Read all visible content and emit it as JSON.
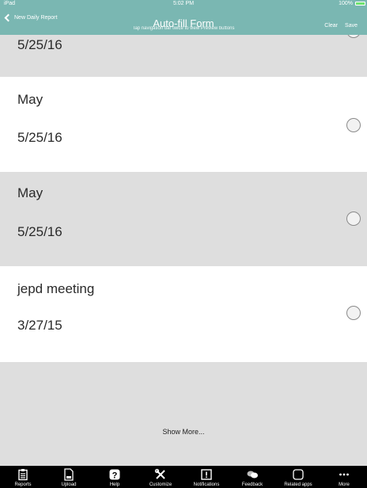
{
  "status_bar": {
    "carrier": "iPad",
    "time": "5:02 PM",
    "battery": "100%"
  },
  "nav": {
    "back_label": "New Daily Report",
    "title": "Auto-fill Form",
    "subtitle": "Tap navigation bar twice to view Preview buttons",
    "clear_label": "Clear",
    "save_label": "Save"
  },
  "rows": [
    {
      "title": "",
      "date": "5/25/16"
    },
    {
      "title": "May",
      "date": "5/25/16"
    },
    {
      "title": "May",
      "date": "5/25/16"
    },
    {
      "title": "jepd meeting",
      "date": "3/27/15"
    }
  ],
  "show_more_label": "Show More...",
  "tabs": [
    {
      "label": "Reports",
      "icon": "clipboard-icon"
    },
    {
      "label": "Upload",
      "icon": "upload-icon"
    },
    {
      "label": "Help",
      "icon": "help-icon"
    },
    {
      "label": "Customize",
      "icon": "tools-icon"
    },
    {
      "label": "Notifications",
      "icon": "notification-icon"
    },
    {
      "label": "Feedback",
      "icon": "chat-icon"
    },
    {
      "label": "Related apps",
      "icon": "apps-icon"
    },
    {
      "label": "More",
      "icon": "more-icon"
    }
  ],
  "colors": {
    "nav_background": "#7ab7b2",
    "row_gray": "#dedede",
    "tab_bar": "#000000"
  }
}
